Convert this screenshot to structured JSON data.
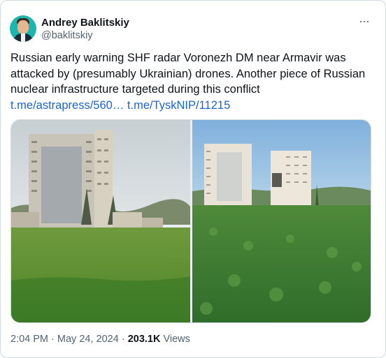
{
  "author": {
    "name": "Andrey Baklitskiy",
    "handle": "@baklitskiy",
    "avatar_icon": "profile-photo-icon"
  },
  "more_icon": "ellipsis-icon",
  "more_label": "···",
  "tweet": {
    "text": "Russian early warning SHF radar Voronezh DM near Armavir was attacked by (presumably Ukrainian) drones. Another piece of Russian nuclear infrastructure targeted during this conflict",
    "link1": "t.me/astrapress/560…",
    "link2": "t.me/TyskNIP/11215"
  },
  "media": {
    "left_image": "radar-photo-cloudy-left",
    "right_image": "radar-photo-sunny-right"
  },
  "meta": {
    "time": "2:04 PM",
    "separator": "·",
    "date": "May 24, 2024",
    "views_count": "203.1K",
    "views_label": "Views"
  },
  "colors": {
    "link": "#1d64c9",
    "secondary": "#536471",
    "border": "#cfd9de"
  }
}
